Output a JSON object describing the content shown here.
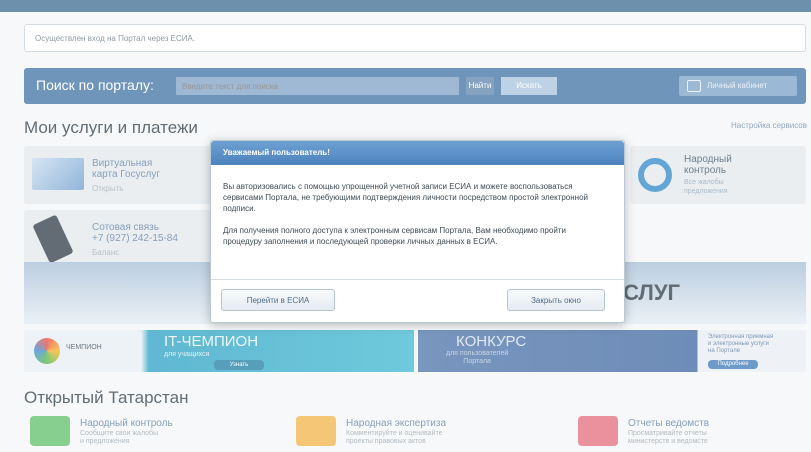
{
  "notice": {
    "text": "Осуществлен вход на Портал через ЕСИА."
  },
  "search": {
    "label": "Поиск по порталу:",
    "placeholder": "Введите текст для поиска",
    "go": "Найти",
    "button": "Искать",
    "cabinet": "Личный кабинет"
  },
  "services": {
    "title": "Мои услуги и платежи",
    "settings_link": "Настройка сервисов",
    "tiles": [
      {
        "title": "Виртуальная\nкарта Госуслуг",
        "sub": "Открыть"
      },
      {
        "title": "Сотовая связь\n+7 (927) 242-15-84",
        "sub": "Баланс"
      }
    ],
    "right_tile": {
      "title": "Народный\nконтроль",
      "sub": "Все жалобы\nпредложения"
    }
  },
  "banner": {
    "text": "СЛУГ"
  },
  "promo": {
    "champion": "ЧЕМПИОН",
    "it_title": "IT-ЧЕМПИОН",
    "it_sub": "для учащихся",
    "it_btn": "Узнать",
    "contest_title": "КОНКУРС",
    "contest_sub": "для пользователей\nПортала",
    "right_text": "Электронная приемная\nи электронные услуги\nна Портале",
    "right_btn": "Подробнее"
  },
  "open": {
    "title": "Открытый Татарстан",
    "items": [
      {
        "title": "Народный контроль",
        "sub": "Сообщите свои жалобы\nи предложения"
      },
      {
        "title": "Народная экспертиза",
        "sub": "Комментируйте и оценивайте\nпроекты правовых актов"
      },
      {
        "title": "Отчеты ведомств",
        "sub": "Просматривайте отчеты\nминистерств и ведомств"
      }
    ]
  },
  "modal": {
    "title": "Уважаемый пользователь!",
    "p1": "Вы авторизовались с помощью упрощенной учетной записи ЕСИА и можете воспользоваться сервисами Портала, не требующими подтверждения личности посредством простой электронной подписи.",
    "p2": "Для получения полного доступа к электронным сервисам Портала, Вам необходимо пройти процедуру заполнения и последующей проверки личных данных в ЕСИА.",
    "btn_esia": "Перейти в ЕСИА",
    "btn_close": "Закрыть окно"
  }
}
